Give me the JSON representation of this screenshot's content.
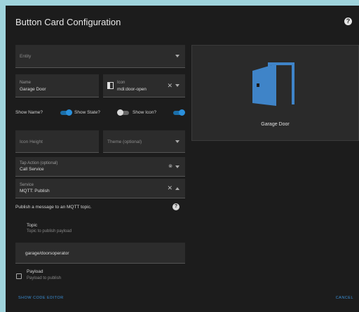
{
  "dialog": {
    "title": "Button Card Configuration"
  },
  "form": {
    "entity": {
      "placeholder": "Entity"
    },
    "name": {
      "label": "Name",
      "value": "Garage Door"
    },
    "icon": {
      "label": "Icon",
      "value": "mdi:door-open"
    },
    "toggles": {
      "show_name": {
        "label": "Show Name?",
        "state": "on"
      },
      "show_state": {
        "label": "Show State?",
        "state": "off"
      },
      "show_icon": {
        "label": "Show Icon?",
        "state": "on"
      }
    },
    "icon_height": {
      "placeholder": "Icon Height"
    },
    "theme": {
      "placeholder": "Theme (optional)"
    },
    "tap_action": {
      "label": "Tap Action (optional)",
      "value": "Call Service"
    },
    "service": {
      "label": "Service",
      "value": "MQTT: Publish"
    },
    "service_description": "Publish a message to an MQTT topic.",
    "topic": {
      "label": "Topic",
      "hint": "Topic to publish payload",
      "value": "garage/doorsoperator"
    },
    "payload": {
      "label": "Payload",
      "hint": "Payload to publish"
    }
  },
  "preview": {
    "label": "Garage Door",
    "icon": "door-open-icon",
    "icon_color": "#3f84c8"
  },
  "footer": {
    "show_code_editor": "SHOW CODE EDITOR",
    "cancel": "CANCEL"
  },
  "colors": {
    "accent": "#2a90dc",
    "background": "#1c1c1c"
  }
}
